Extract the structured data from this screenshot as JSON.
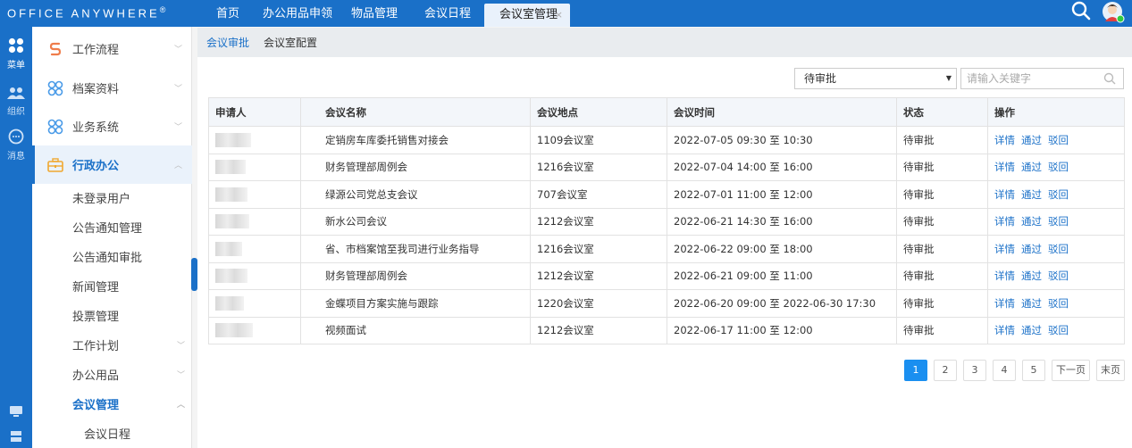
{
  "app": {
    "logo_text": "Office Anywhere",
    "logo_mark": "®"
  },
  "top_tabs": [
    {
      "label": "首页"
    },
    {
      "label": "办公用品申领"
    },
    {
      "label": "物品管理"
    },
    {
      "label": "会议日程"
    },
    {
      "label": "会议室管理",
      "closable": true,
      "close_glyph": "×"
    }
  ],
  "rail": [
    {
      "icon": "grid-icon",
      "label": "菜单"
    },
    {
      "icon": "users-icon",
      "label": "组织"
    },
    {
      "icon": "chat-icon",
      "label": "消息"
    },
    {
      "icon": "monitor-icon",
      "label": ""
    },
    {
      "icon": "server-icon",
      "label": ""
    }
  ],
  "sidebar": {
    "groups": [
      {
        "label": "工作流程",
        "icon": "workflow-icon"
      },
      {
        "label": "档案资料",
        "icon": "clover-icon"
      },
      {
        "label": "业务系统",
        "icon": "clover-icon"
      },
      {
        "label": "行政办公",
        "icon": "briefcase-icon"
      }
    ],
    "sub_items": [
      {
        "label": "未登录用户"
      },
      {
        "label": "公告通知管理"
      },
      {
        "label": "公告通知审批"
      },
      {
        "label": "新闻管理"
      },
      {
        "label": "投票管理"
      },
      {
        "label": "工作计划"
      },
      {
        "label": "办公用品"
      },
      {
        "label": "会议管理"
      },
      {
        "label": "会议日程"
      }
    ]
  },
  "sub_tabs": [
    {
      "label": "会议审批"
    },
    {
      "label": "会议室配置"
    }
  ],
  "filter": {
    "status_value": "待审批",
    "search_placeholder": "请输入关键字"
  },
  "table": {
    "headers": [
      "申请人",
      "会议名称",
      "会议地点",
      "会议时间",
      "状态",
      "操作"
    ],
    "actions": [
      "详情",
      "通过",
      "驳回"
    ],
    "rows": [
      {
        "name": "定销房车库委托销售对接会",
        "location": "1109会议室",
        "time": "2022-07-05 09:30 至 10:30",
        "status": "待审批"
      },
      {
        "name": "财务管理部周例会",
        "location": "1216会议室",
        "time": "2022-07-04 14:00 至 16:00",
        "status": "待审批"
      },
      {
        "name": "绿源公司党总支会议",
        "location": "707会议室",
        "time": "2022-07-01 11:00 至 12:00",
        "status": "待审批"
      },
      {
        "name": "新水公司会议",
        "location": "1212会议室",
        "time": "2022-06-21 14:30 至 16:00",
        "status": "待审批"
      },
      {
        "name": "省、市档案馆至我司进行业务指导",
        "location": "1216会议室",
        "time": "2022-06-22 09:00 至 18:00",
        "status": "待审批"
      },
      {
        "name": "财务管理部周例会",
        "location": "1212会议室",
        "time": "2022-06-21 09:00 至 11:00",
        "status": "待审批"
      },
      {
        "name": "金蝶项目方案实施与跟踪",
        "location": "1220会议室",
        "time": "2022-06-20 09:00 至 2022-06-30 17:30",
        "status": "待审批"
      },
      {
        "name": "视频面试",
        "location": "1212会议室",
        "time": "2022-06-17 11:00 至 12:00",
        "status": "待审批"
      }
    ]
  },
  "pager": {
    "pages": [
      "1",
      "2",
      "3",
      "4",
      "5"
    ],
    "current_page": 1,
    "next_label": "下一页",
    "last_label": "末页"
  },
  "colors": {
    "primary": "#1a70c8",
    "page_active": "#1a8ff0",
    "avatar_status": "#2ecc40"
  }
}
